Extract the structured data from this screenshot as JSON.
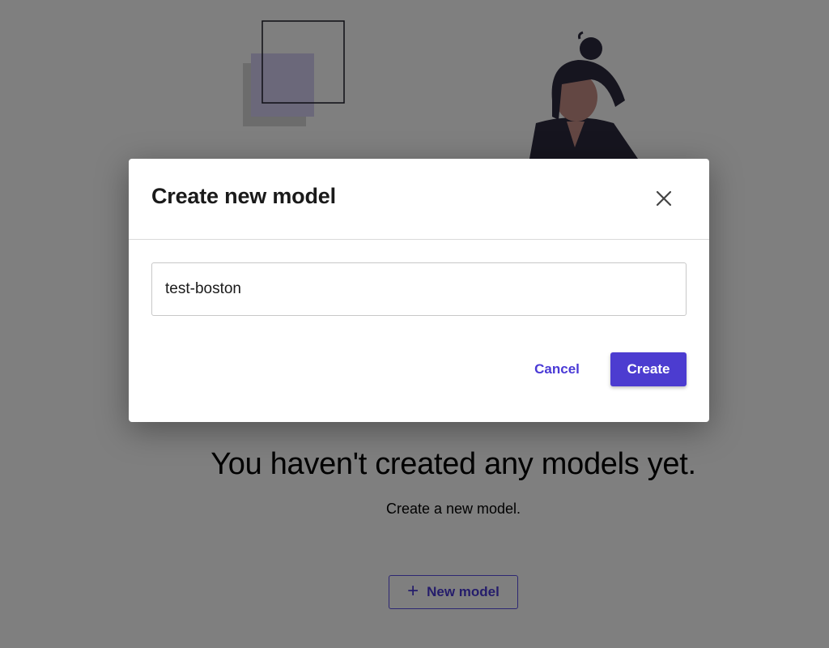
{
  "empty_state": {
    "title": "You haven't created any models yet.",
    "subtitle": "Create a new model.",
    "new_model_label": "New model",
    "plus_glyph": "+"
  },
  "modal": {
    "title": "Create new model",
    "close_icon": "close-icon",
    "name_input_value": "test-boston",
    "cancel_label": "Cancel",
    "create_label": "Create"
  },
  "colors": {
    "accent": "#4c3cd0",
    "overlay": "rgba(0,0,0,0.5)"
  }
}
